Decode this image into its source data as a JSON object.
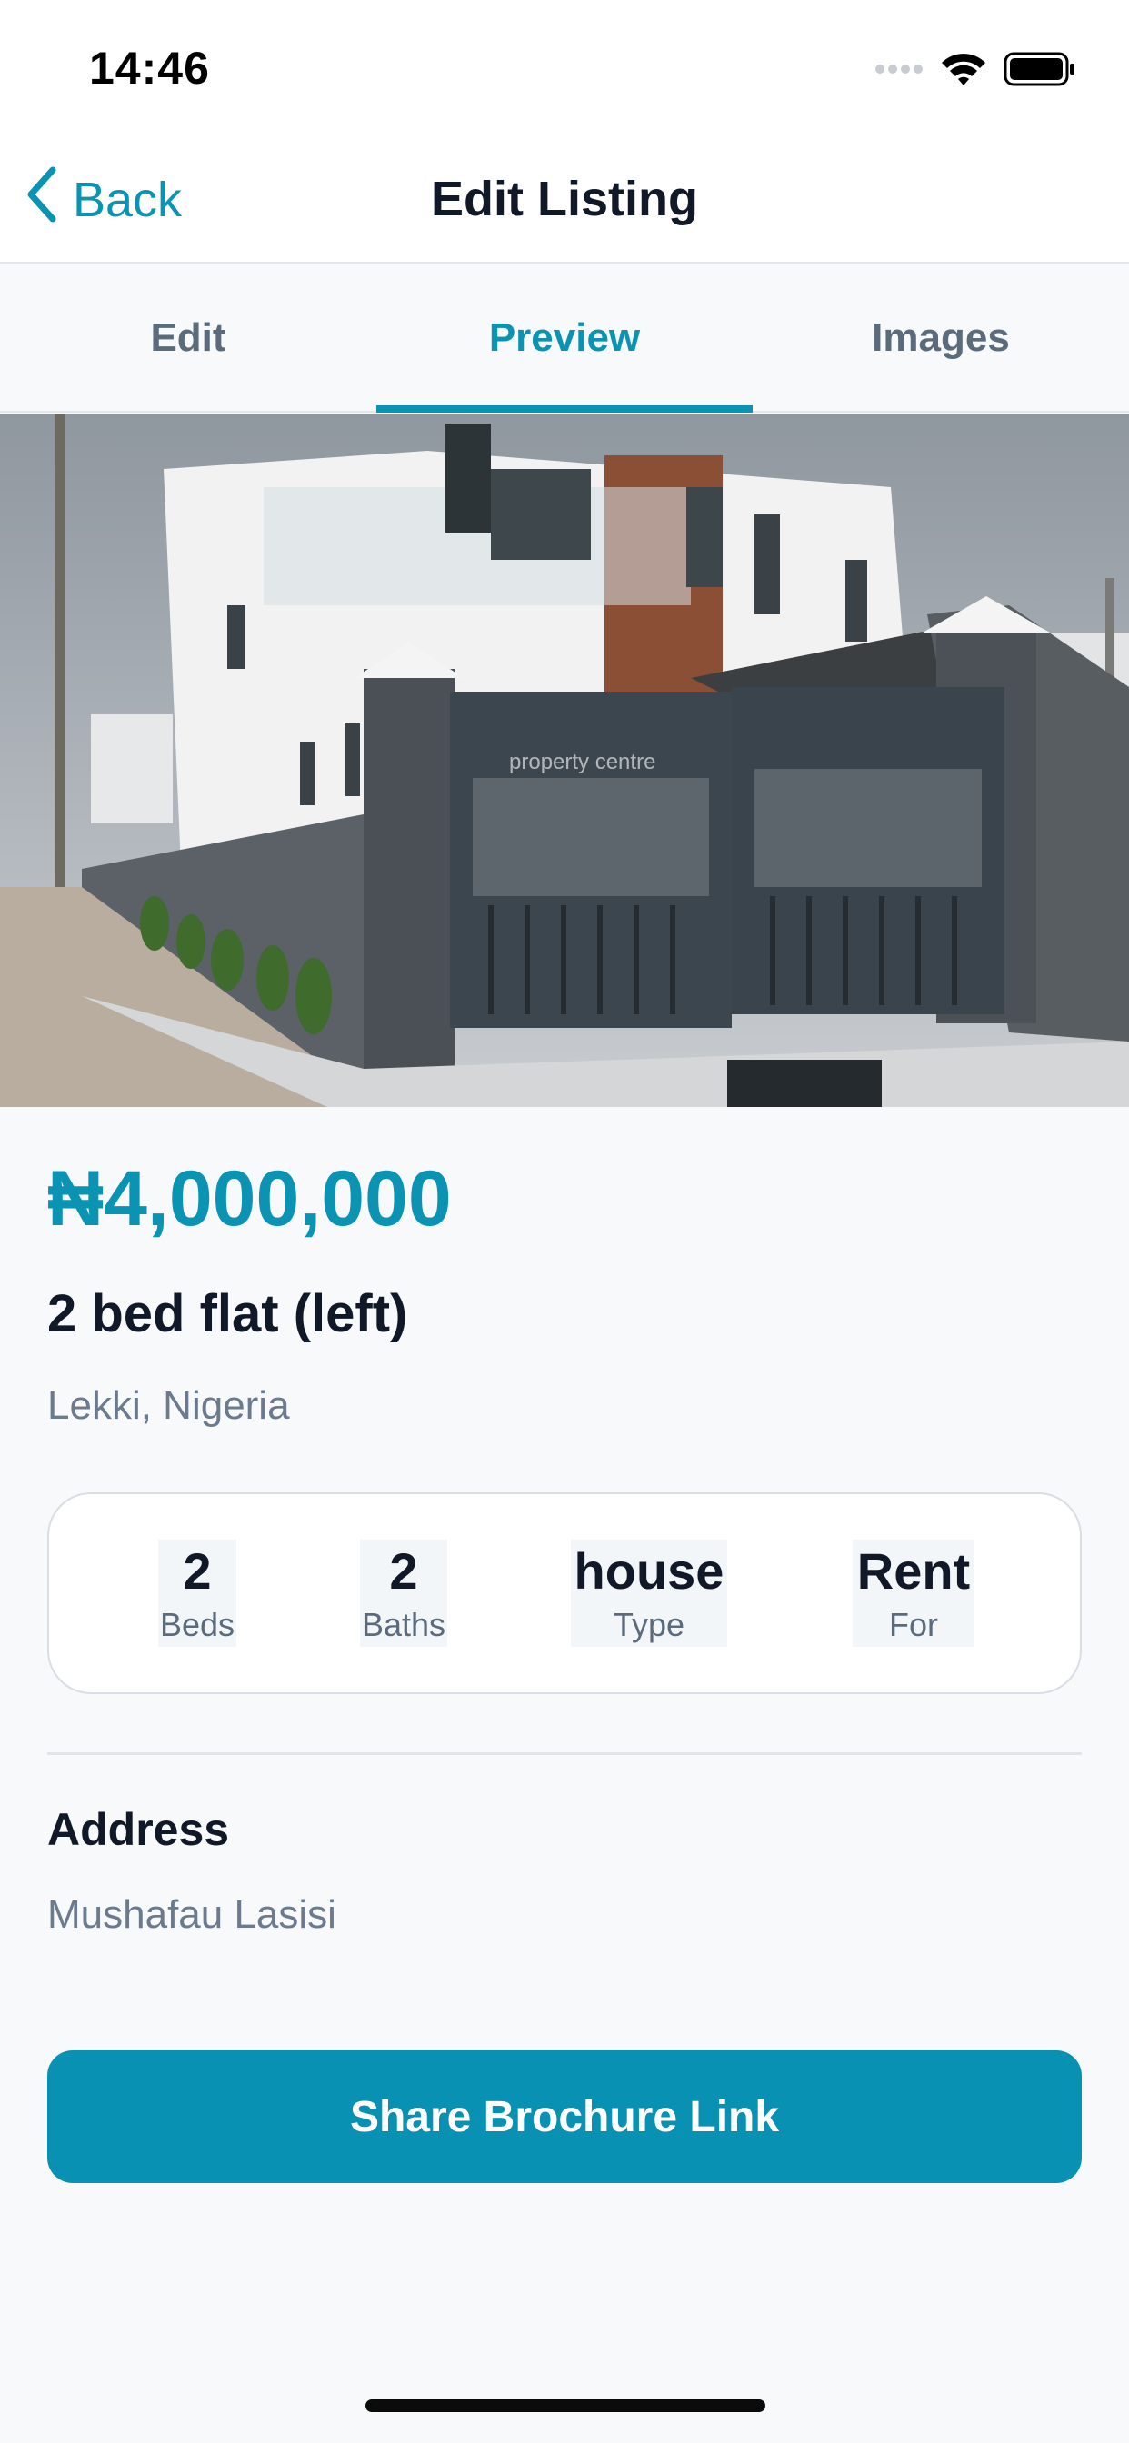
{
  "status_bar": {
    "time": "14:46"
  },
  "nav": {
    "back_label": "Back",
    "title": "Edit Listing"
  },
  "tabs": [
    {
      "label": "Edit",
      "active": false
    },
    {
      "label": "Preview",
      "active": true
    },
    {
      "label": "Images",
      "active": false
    }
  ],
  "hero_image": {
    "watermark": "property centre"
  },
  "listing": {
    "price": "₦4,000,000",
    "title": "2 bed flat (left)",
    "location": "Lekki, Nigeria"
  },
  "stats": [
    {
      "value": "2",
      "label": "Beds"
    },
    {
      "value": "2",
      "label": "Baths"
    },
    {
      "value": "house",
      "label": "Type"
    },
    {
      "value": "Rent",
      "label": "For"
    }
  ],
  "address": {
    "heading": "Address",
    "value": "Mushafau Lasisi"
  },
  "share_button": {
    "label": "Share Brochure Link"
  },
  "colors": {
    "accent": "#0b93b4",
    "button": "#0891b2"
  },
  "icons": [
    "signal-icon",
    "wifi-icon",
    "battery-icon",
    "chevron-left-icon"
  ]
}
